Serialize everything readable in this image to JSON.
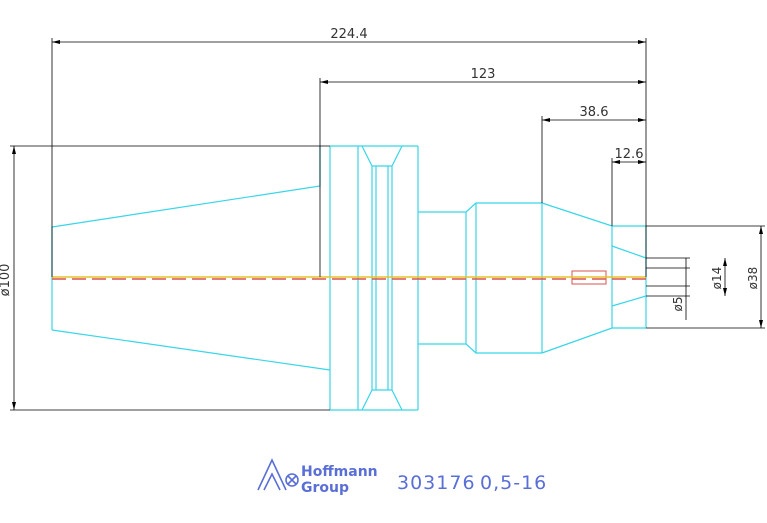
{
  "drawing": {
    "colors": {
      "outline": "#38d6e8",
      "dimension": "#000000",
      "centerline_red": "#d9534f",
      "centerline_yellow": "#e6c229",
      "brand": "#5a6fd6"
    },
    "dimensions": {
      "overall_length": "224.4",
      "taper_length": "123",
      "nose_length": "38.6",
      "tip_length": "12.6",
      "flange_diameter": "ø100",
      "bore_diameter": "ø5",
      "nut_diameter": "ø14",
      "collet_diameter": "ø38"
    }
  },
  "footer": {
    "logo_line1": "Hoffmann",
    "logo_line2": "Group",
    "logo_icon": "hoffmann-logo-icon",
    "part_number": "303176",
    "range": "0,5-16"
  }
}
